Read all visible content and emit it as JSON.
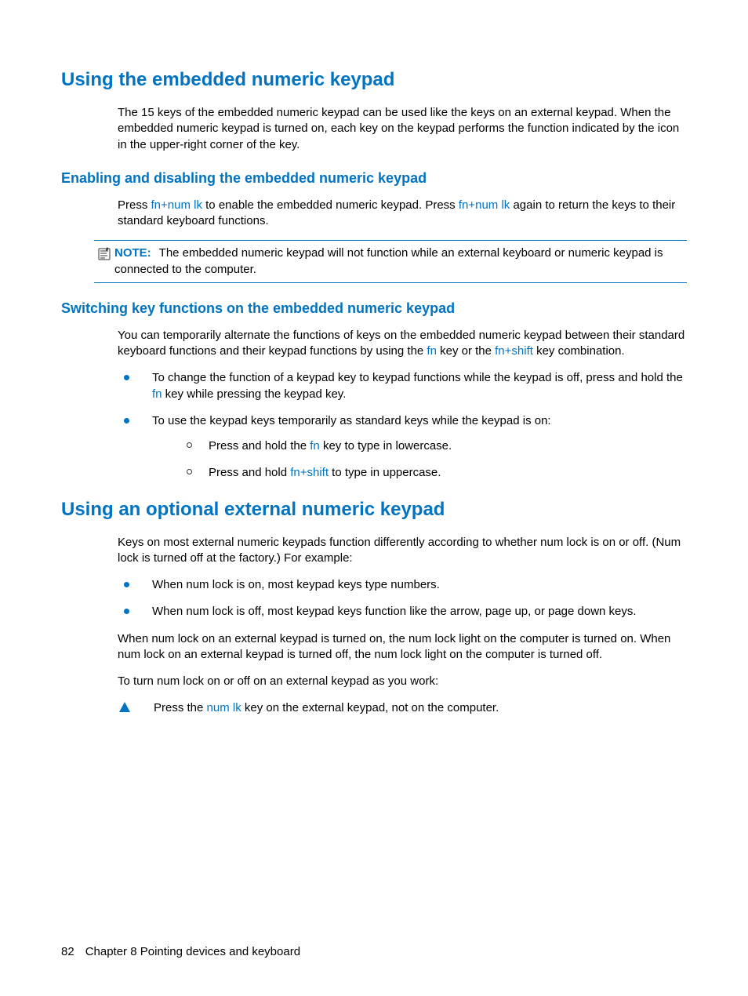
{
  "h1a": "Using the embedded numeric keypad",
  "p1": "The 15 keys of the embedded numeric keypad can be used like the keys on an external keypad. When the embedded numeric keypad is turned on, each key on the keypad performs the function indicated by the icon in the upper-right corner of the key.",
  "h2a": "Enabling and disabling the embedded numeric keypad",
  "p2a": "Press ",
  "p2b": "fn+num lk",
  "p2c": " to enable the embedded numeric keypad. Press ",
  "p2d": "fn+num lk",
  "p2e": " again to return the keys to their standard keyboard functions.",
  "noteLabel": "NOTE:",
  "noteText": "The embedded numeric keypad will not function while an external keyboard or numeric keypad is connected to the computer.",
  "h2b": "Switching key functions on the embedded numeric keypad",
  "p3a": "You can temporarily alternate the functions of keys on the embedded numeric keypad between their standard keyboard functions and their keypad functions by using the ",
  "p3b": "fn",
  "p3c": " key or the ",
  "p3d": "fn+shift",
  "p3e": " key combination.",
  "li1a": "To change the function of a keypad key to keypad functions while the keypad is off, press and hold the ",
  "li1b": "fn",
  "li1c": " key while pressing the keypad key.",
  "li2": "To use the keypad keys temporarily as standard keys while the keypad is on:",
  "sub1a": "Press and hold the ",
  "sub1b": "fn",
  "sub1c": " key to type in lowercase.",
  "sub2a": "Press and hold ",
  "sub2b": "fn+shift",
  "sub2c": " to type in uppercase.",
  "h1b": "Using an optional external numeric keypad",
  "p4": "Keys on most external numeric keypads function differently according to whether num lock is on or off. (Num lock is turned off at the factory.) For example:",
  "li3": "When num lock is on, most keypad keys type numbers.",
  "li4": "When num lock is off, most keypad keys function like the arrow, page up, or page down keys.",
  "p5": "When num lock on an external keypad is turned on, the num lock light on the computer is turned on. When num lock on an external keypad is turned off, the num lock light on the computer is turned off.",
  "p6": "To turn num lock on or off on an external keypad as you work:",
  "tri_a": "Press the ",
  "tri_b": "num lk",
  "tri_c": " key on the external keypad, not on the computer.",
  "footer_page": "82",
  "footer_chapter": "Chapter 8   Pointing devices and keyboard"
}
